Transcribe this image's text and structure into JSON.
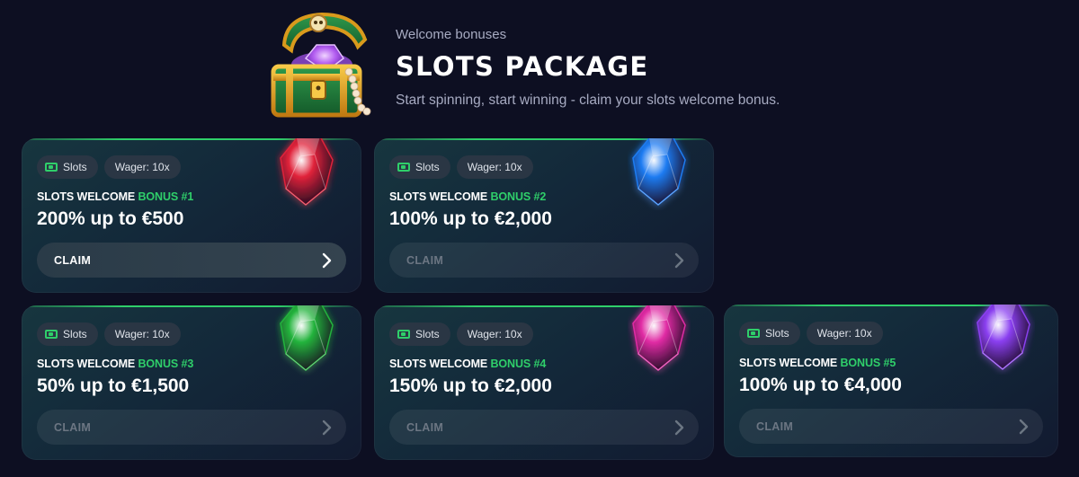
{
  "header": {
    "subtitle": "Welcome bonuses",
    "title": "SLOTS PACKAGE",
    "tagline": "Start spinning, start winning - claim your slots welcome bonus.",
    "icon": "treasure-chest-icon"
  },
  "colors": {
    "accent_green": "#2fcf6a",
    "background": "#0d0f22"
  },
  "cards": [
    {
      "tag_game": "Slots",
      "tag_wager": "Wager: 10x",
      "label_prefix": "SLOTS WELCOME",
      "label_suffix": "BONUS #1",
      "amount": "200% up to €500",
      "claim": "CLAIM",
      "claim_state": "active",
      "gem": "red-gem-icon",
      "gem_color": "#e0223a"
    },
    {
      "tag_game": "Slots",
      "tag_wager": "Wager: 10x",
      "label_prefix": "SLOTS WELCOME",
      "label_suffix": "BONUS #2",
      "amount": "100% up to €2,000",
      "claim": "CLAIM",
      "claim_state": "disabled",
      "gem": "blue-gem-icon",
      "gem_color": "#1f7cf2"
    },
    {
      "tag_game": "Slots",
      "tag_wager": "Wager: 10x",
      "label_prefix": "SLOTS WELCOME",
      "label_suffix": "BONUS #3",
      "amount": "50% up to €1,500",
      "claim": "CLAIM",
      "claim_state": "disabled",
      "gem": "green-gem-icon",
      "gem_color": "#22b33c"
    },
    {
      "tag_game": "Slots",
      "tag_wager": "Wager: 10x",
      "label_prefix": "SLOTS WELCOME",
      "label_suffix": "BONUS #4",
      "amount": "150% up to €2,000",
      "claim": "CLAIM",
      "claim_state": "disabled",
      "gem": "pink-gem-icon",
      "gem_color": "#e02ba4"
    },
    {
      "tag_game": "Slots",
      "tag_wager": "Wager: 10x",
      "label_prefix": "SLOTS WELCOME",
      "label_suffix": "BONUS #5",
      "amount": "100% up to €4,000",
      "claim": "CLAIM",
      "claim_state": "disabled",
      "gem": "purple-gem-icon",
      "gem_color": "#8a3ff0"
    }
  ]
}
